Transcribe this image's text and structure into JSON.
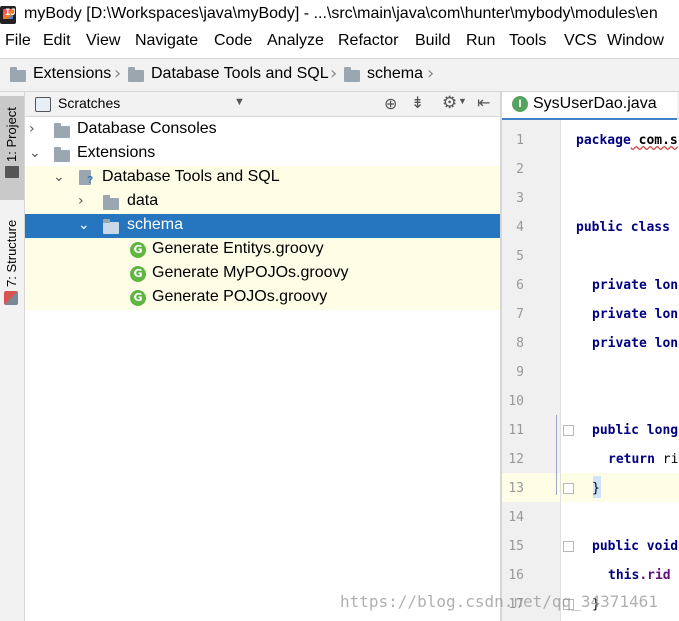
{
  "window": {
    "title": "myBody [D:\\Workspaces\\java\\myBody] - ...\\src\\main\\java\\com\\hunter\\mybody\\modules\\en",
    "app_icon_letters": "IJ"
  },
  "menu": [
    "File",
    "Edit",
    "View",
    "Navigate",
    "Code",
    "Analyze",
    "Refactor",
    "Build",
    "Run",
    "Tools",
    "VCS",
    "Window"
  ],
  "breadcrumbs": [
    "Extensions",
    "Database Tools and SQL",
    "schema"
  ],
  "tool_stripe": {
    "project_tab": "1: Project",
    "structure_tab": "7: Structure"
  },
  "panel": {
    "view": "Scratches"
  },
  "tree": [
    {
      "label": "Database Consoles",
      "expanded": false
    },
    {
      "label": "Extensions",
      "expanded": true
    },
    {
      "label": "Database Tools and SQL",
      "expanded": true
    },
    {
      "label": "data",
      "expanded": false
    },
    {
      "label": "schema",
      "expanded": true,
      "selected": true
    },
    {
      "label": "Generate Entitys.groovy"
    },
    {
      "label": "Generate MyPOJOs.groovy"
    },
    {
      "label": "Generate POJOs.groovy"
    }
  ],
  "editor": {
    "tab_label": "SysUserDao.java",
    "tab_icon_letter": "I",
    "groovy_icon_letter": "G",
    "current_line": 13,
    "lines": [
      {
        "n": "1",
        "kw": "package",
        "rest": " com.s"
      },
      {
        "n": "2",
        "kw": "",
        "rest": ""
      },
      {
        "n": "3",
        "kw": "",
        "rest": ""
      },
      {
        "n": "4",
        "kw": "public class",
        "rest": ""
      },
      {
        "n": "5",
        "kw": "",
        "rest": ""
      },
      {
        "n": "6",
        "kw": "private lon",
        "rest": ""
      },
      {
        "n": "7",
        "kw": "private lon",
        "rest": ""
      },
      {
        "n": "8",
        "kw": "private lon",
        "rest": ""
      },
      {
        "n": "9",
        "kw": "",
        "rest": ""
      },
      {
        "n": "10",
        "kw": "",
        "rest": ""
      },
      {
        "n": "11",
        "kw": "public long",
        "rest": ""
      },
      {
        "n": "12",
        "kw": "return",
        "rest": " ri"
      },
      {
        "n": "13",
        "kw": "",
        "rest": "}"
      },
      {
        "n": "14",
        "kw": "",
        "rest": ""
      },
      {
        "n": "15",
        "kw": "public void",
        "rest": ""
      },
      {
        "n": "16",
        "kw": "this",
        "rest": ".rid"
      },
      {
        "n": "17",
        "kw": "",
        "rest": "}"
      }
    ]
  },
  "watermark": "https://blog.csdn.net/qq_34371461"
}
